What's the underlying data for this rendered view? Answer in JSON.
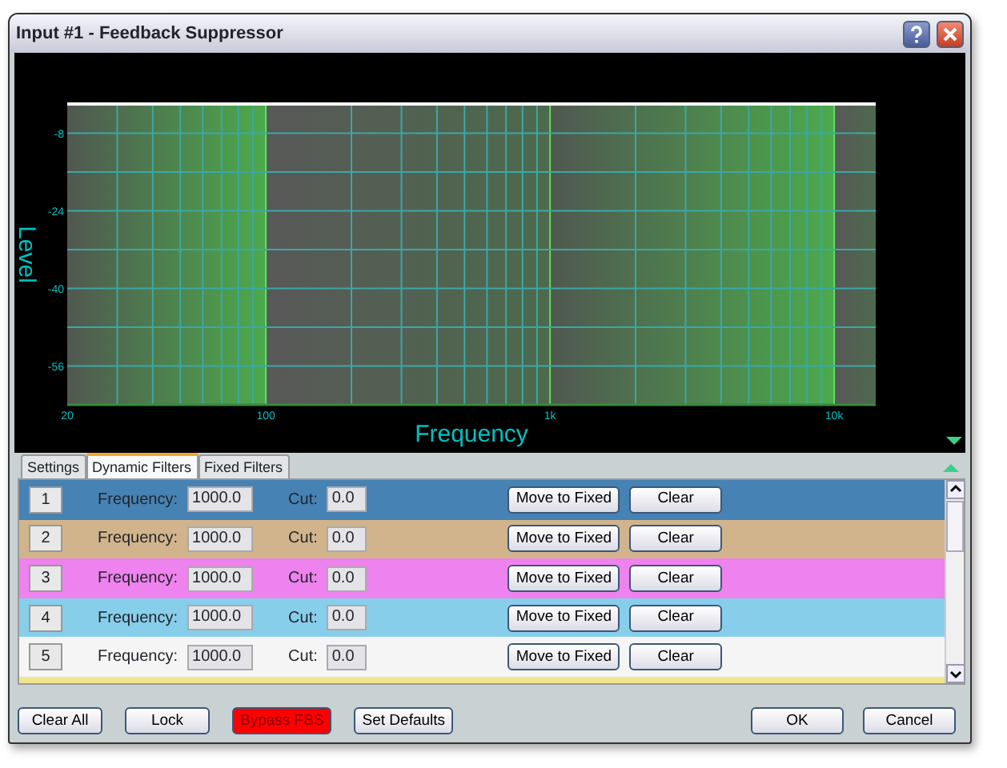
{
  "window": {
    "title": "Input #1 - Feedback Suppressor"
  },
  "chart": {
    "x_axis_title": "Frequency",
    "y_axis_title": "Level",
    "x_tick_labels": [
      "20",
      "100",
      "1k",
      "10k"
    ],
    "y_tick_labels": [
      "-8",
      "-24",
      "-40",
      "-56"
    ]
  },
  "tabs": [
    {
      "label": "Settings",
      "selected": false
    },
    {
      "label": "Dynamic Filters",
      "selected": true
    },
    {
      "label": "Fixed Filters",
      "selected": false
    }
  ],
  "filters": [
    {
      "number": "1",
      "frequency_label": "Frequency:",
      "frequency": "1000.0",
      "cut_label": "Cut:",
      "cut": "0.0",
      "move_button": "Move to Fixed",
      "clear_button": "Clear",
      "color": "#4682b4"
    },
    {
      "number": "2",
      "frequency_label": "Frequency:",
      "frequency": "1000.0",
      "cut_label": "Cut:",
      "cut": "0.0",
      "move_button": "Move to Fixed",
      "clear_button": "Clear",
      "color": "#d2b48c"
    },
    {
      "number": "3",
      "frequency_label": "Frequency:",
      "frequency": "1000.0",
      "cut_label": "Cut:",
      "cut": "0.0",
      "move_button": "Move to Fixed",
      "clear_button": "Clear",
      "color": "#ee82ee"
    },
    {
      "number": "4",
      "frequency_label": "Frequency:",
      "frequency": "1000.0",
      "cut_label": "Cut:",
      "cut": "0.0",
      "move_button": "Move to Fixed",
      "clear_button": "Clear",
      "color": "#87ceeb"
    },
    {
      "number": "5",
      "frequency_label": "Frequency:",
      "frequency": "1000.0",
      "cut_label": "Cut:",
      "cut": "0.0",
      "move_button": "Move to Fixed",
      "clear_button": "Clear",
      "color": "#f5f5f5"
    }
  ],
  "next_row": {
    "color": "#f0e68c"
  },
  "bottom_buttons": [
    {
      "label": "Clear All",
      "on": false
    },
    {
      "label": "Lock",
      "on": false
    },
    {
      "label": "Bypass FBS",
      "on": true
    },
    {
      "label": "Set Defaults",
      "on": false
    }
  ],
  "dialog_buttons": [
    "OK",
    "Cancel"
  ]
}
